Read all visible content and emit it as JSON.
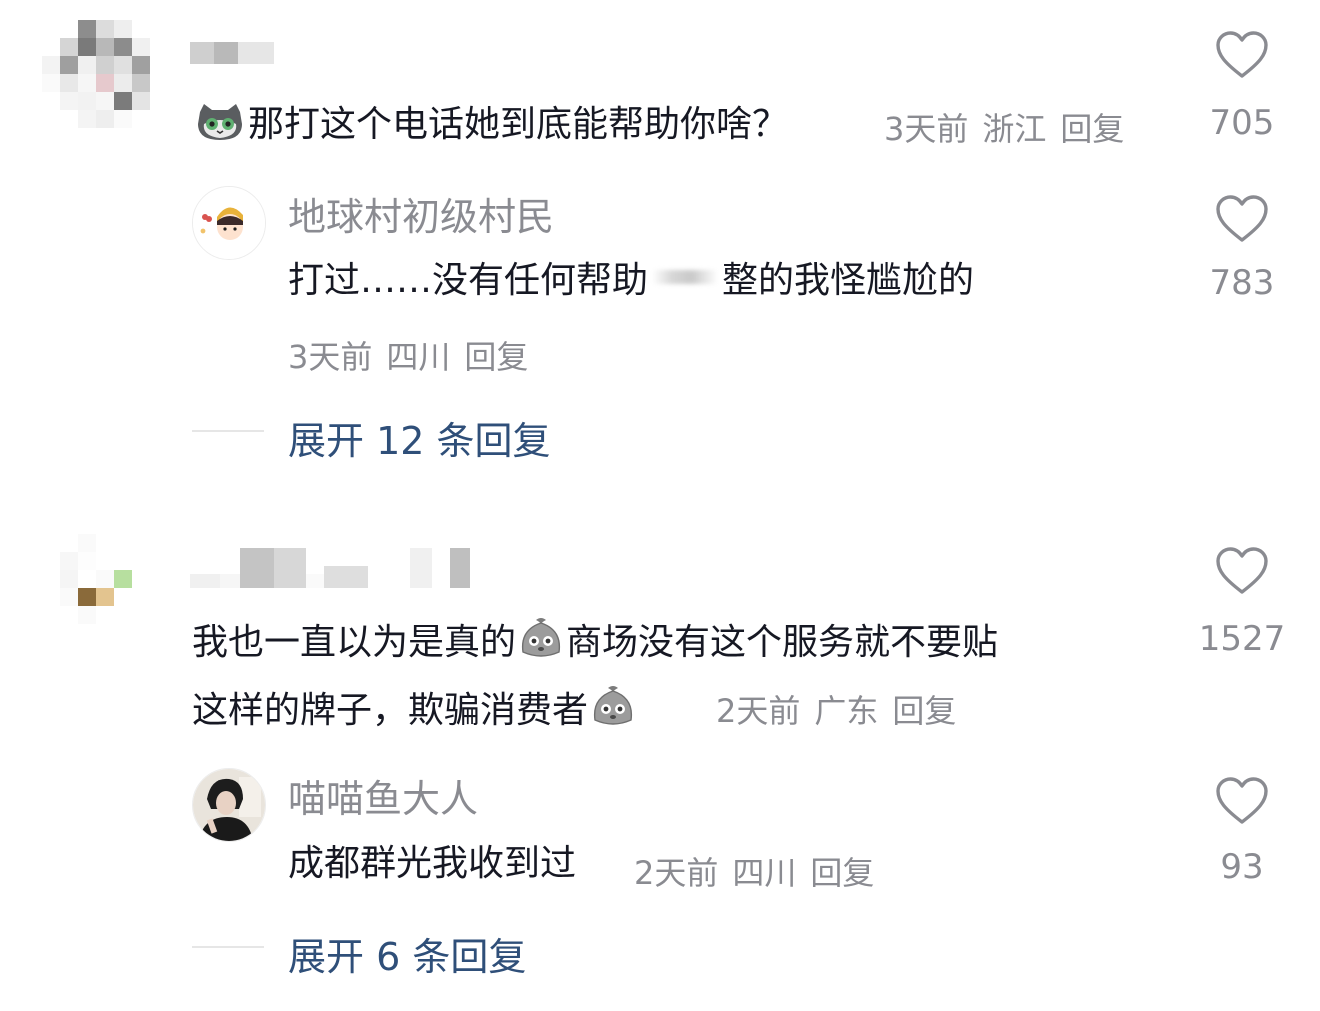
{
  "comments": [
    {
      "text": "那打这个电话她到底能帮助你啥？",
      "emoji": "cat-face-emoji",
      "time": "3天前",
      "location": "浙江",
      "reply_label": "回复",
      "likes": "705",
      "reply": {
        "name": "地球村初级村民",
        "text_before": "打过……没有任何帮助",
        "text_after": "整的我怪尴尬的",
        "time": "3天前",
        "location": "四川",
        "reply_label": "回复",
        "likes": "783"
      },
      "expand_label": "展开 12 条回复"
    },
    {
      "text_line1_before": "我也一直以为是真的",
      "text_line1_after": "商场没有这个服务就不要贴",
      "text_line2": "这样的牌子，欺骗消费者",
      "emoji": "dumpling-face-emoji",
      "time": "2天前",
      "location": "广东",
      "reply_label": "回复",
      "likes": "1527",
      "reply": {
        "name": "喵喵鱼大人",
        "text": "成都群光我收到过",
        "time": "2天前",
        "location": "四川",
        "reply_label": "回复",
        "likes": "93"
      },
      "expand_label": "展开 6 条回复"
    }
  ],
  "colors": {
    "text": "#161823",
    "meta": "#8a8b91",
    "expand": "#2f4f79",
    "divider": "#e6e6e6"
  }
}
